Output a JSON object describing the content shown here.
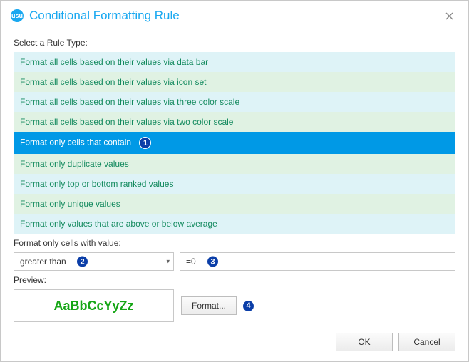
{
  "dialog": {
    "title": "Conditional Formatting Rule",
    "select_label": "Select a Rule Type:",
    "rules": [
      "Format all cells based on their values via data bar",
      "Format all cells based on their values via icon set",
      "Format all cells based on their values via three color scale",
      "Format all cells based on their values via two color scale",
      "Format only cells that contain",
      "Format only duplicate values",
      "Format only top or bottom ranked values",
      "Format only unique values",
      "Format only values that are above or below average"
    ],
    "value_section_label": "Format only cells with value:",
    "operator": "greater than",
    "value": "=0",
    "preview_label": "Preview:",
    "preview_sample": "AaBbCcYyZz",
    "format_button": "Format...",
    "ok_button": "OK",
    "cancel_button": "Cancel"
  },
  "callouts": {
    "c1": "1",
    "c2": "2",
    "c3": "3",
    "c4": "4"
  }
}
